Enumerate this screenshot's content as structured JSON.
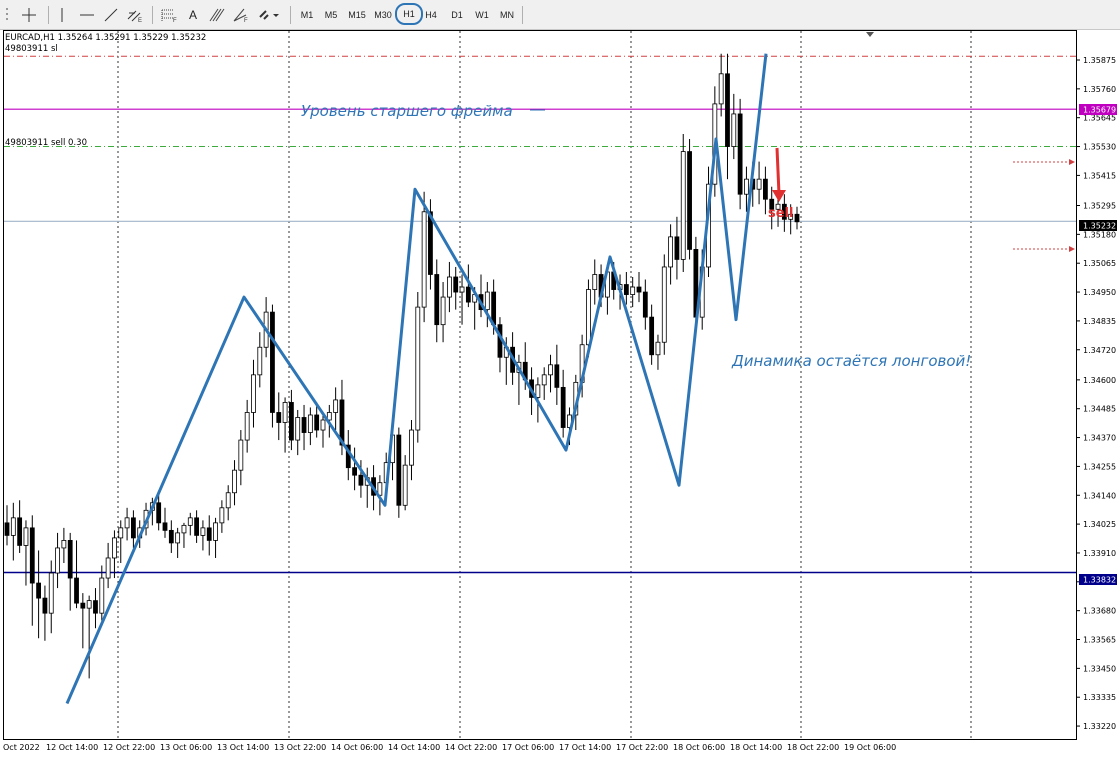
{
  "toolbar": {
    "timeframes": [
      "M1",
      "M5",
      "M15",
      "M30",
      "H1",
      "H4",
      "D1",
      "W1",
      "MN"
    ],
    "selected_timeframe": "H1",
    "tools": [
      "crosshair-icon",
      "vertical-line-icon",
      "horizontal-line-icon",
      "trendline-icon",
      "channel-icon",
      "fibonacci-icon",
      "text-icon",
      "andrews-pitchfork-icon",
      "gann-icon",
      "shapes-icon"
    ],
    "text_tool_label": "A"
  },
  "chart": {
    "info_line": "EURCAD,H1  1.35264 1.35291 1.35229 1.35232",
    "order_sl_label": "49803911 sl",
    "order_sell_label": "49803911 sell 0.30",
    "bid_label": "1.35232",
    "level_label": "1.35679",
    "support_label": "1.33832",
    "annotation_level": "Уровень старшего фрейма",
    "annotation_dynamics": "Динамика остаётся лонговой!",
    "annotation_sell": "sell",
    "colors": {
      "level_magenta": "#c000c0",
      "support_navy": "#00008b",
      "bid_line": "#a0b4c8",
      "sl_line": "#d04040",
      "sell_line": "#3caa3c",
      "zigzag": "#2e75b6",
      "sell_arrow": "#e03030",
      "annotation_blue": "#2e75b6"
    }
  },
  "price_axis": {
    "ticks": [
      "1.35875",
      "1.35760",
      "1.35645",
      "1.35530",
      "1.35415",
      "1.35295",
      "1.35180",
      "1.35065",
      "1.34950",
      "1.34835",
      "1.34720",
      "1.34600",
      "1.34485",
      "1.34370",
      "1.34255",
      "1.34140",
      "1.34025",
      "1.33910",
      "1.33795",
      "1.33680",
      "1.33565",
      "1.33450",
      "1.33335",
      "1.33220"
    ]
  },
  "time_axis": {
    "labels": [
      "Oct 2022",
      "12 Oct 14:00",
      "12 Oct 22:00",
      "13 Oct 06:00",
      "13 Oct 14:00",
      "13 Oct 22:00",
      "14 Oct 06:00",
      "14 Oct 14:00",
      "14 Oct 22:00",
      "17 Oct 06:00",
      "17 Oct 14:00",
      "17 Oct 22:00",
      "18 Oct 06:00",
      "18 Oct 14:00",
      "18 Oct 22:00",
      "19 Oct 06:00"
    ]
  },
  "chart_data": {
    "type": "candlestick",
    "symbol": "EURCAD",
    "timeframe": "H1",
    "ylim": [
      1.3322,
      1.3598
    ],
    "levels": [
      {
        "value": 1.35679
      },
      {
        "value": 1.33832
      },
      {
        "value": 1.35232
      },
      {
        "value": 1.3589
      },
      {
        "value": 1.3553
      }
    ],
    "candles": [
      [
        1.3403,
        1.341,
        1.3394,
        1.3398
      ],
      [
        1.3398,
        1.3411,
        1.3388,
        1.3405
      ],
      [
        1.3405,
        1.3412,
        1.3391,
        1.3394
      ],
      [
        1.3394,
        1.3404,
        1.3378,
        1.3401
      ],
      [
        1.3401,
        1.3406,
        1.3362,
        1.3379
      ],
      [
        1.3379,
        1.3392,
        1.3357,
        1.3373
      ],
      [
        1.3373,
        1.3378,
        1.3356,
        1.3367
      ],
      [
        1.3367,
        1.3388,
        1.3359,
        1.3383
      ],
      [
        1.3383,
        1.3399,
        1.3377,
        1.3393
      ],
      [
        1.3393,
        1.3401,
        1.3387,
        1.3396
      ],
      [
        1.3396,
        1.3399,
        1.3368,
        1.3381
      ],
      [
        1.3381,
        1.3396,
        1.3369,
        1.3371
      ],
      [
        1.3371,
        1.3375,
        1.3353,
        1.3369
      ],
      [
        1.3369,
        1.3374,
        1.3341,
        1.3372
      ],
      [
        1.3372,
        1.3377,
        1.3361,
        1.3367
      ],
      [
        1.3367,
        1.3386,
        1.3364,
        1.3381
      ],
      [
        1.3381,
        1.3395,
        1.3377,
        1.3389
      ],
      [
        1.3389,
        1.34,
        1.3381,
        1.3397
      ],
      [
        1.3397,
        1.3404,
        1.3387,
        1.3401
      ],
      [
        1.3401,
        1.3409,
        1.3396,
        1.3405
      ],
      [
        1.3405,
        1.3408,
        1.3393,
        1.3397
      ],
      [
        1.3397,
        1.3404,
        1.3393,
        1.3401
      ],
      [
        1.3401,
        1.3411,
        1.3398,
        1.3408
      ],
      [
        1.3408,
        1.3413,
        1.3402,
        1.3411
      ],
      [
        1.3411,
        1.3414,
        1.34,
        1.3403
      ],
      [
        1.3403,
        1.3409,
        1.3397,
        1.34
      ],
      [
        1.34,
        1.3404,
        1.3391,
        1.3395
      ],
      [
        1.3395,
        1.3401,
        1.3389,
        1.3399
      ],
      [
        1.3399,
        1.3403,
        1.3393,
        1.3402
      ],
      [
        1.3402,
        1.3407,
        1.3398,
        1.3405
      ],
      [
        1.3405,
        1.3408,
        1.3395,
        1.3398
      ],
      [
        1.3398,
        1.3404,
        1.3392,
        1.3401
      ],
      [
        1.3401,
        1.3406,
        1.339,
        1.3396
      ],
      [
        1.3396,
        1.3405,
        1.3389,
        1.3403
      ],
      [
        1.3403,
        1.3412,
        1.3399,
        1.3409
      ],
      [
        1.3409,
        1.3418,
        1.3404,
        1.3415
      ],
      [
        1.3415,
        1.3428,
        1.341,
        1.3424
      ],
      [
        1.3424,
        1.344,
        1.3418,
        1.3436
      ],
      [
        1.3436,
        1.3452,
        1.3431,
        1.3447
      ],
      [
        1.3447,
        1.3468,
        1.3441,
        1.3462
      ],
      [
        1.3462,
        1.3479,
        1.3457,
        1.3473
      ],
      [
        1.3473,
        1.3493,
        1.3469,
        1.3487
      ],
      [
        1.3487,
        1.349,
        1.3441,
        1.3447
      ],
      [
        1.3447,
        1.3455,
        1.3436,
        1.3443
      ],
      [
        1.3443,
        1.3453,
        1.3431,
        1.3451
      ],
      [
        1.3451,
        1.3456,
        1.3432,
        1.3436
      ],
      [
        1.3436,
        1.3448,
        1.343,
        1.3445
      ],
      [
        1.3445,
        1.345,
        1.3432,
        1.3439
      ],
      [
        1.3439,
        1.3449,
        1.3434,
        1.3446
      ],
      [
        1.3446,
        1.3451,
        1.3437,
        1.344
      ],
      [
        1.344,
        1.3447,
        1.3433,
        1.3444
      ],
      [
        1.3444,
        1.345,
        1.3437,
        1.3447
      ],
      [
        1.3447,
        1.3457,
        1.344,
        1.3452
      ],
      [
        1.3452,
        1.346,
        1.343,
        1.3434
      ],
      [
        1.3434,
        1.344,
        1.342,
        1.3425
      ],
      [
        1.3425,
        1.3433,
        1.3416,
        1.3422
      ],
      [
        1.3422,
        1.3428,
        1.3413,
        1.3418
      ],
      [
        1.3418,
        1.3425,
        1.3409,
        1.3421
      ],
      [
        1.3421,
        1.3426,
        1.3408,
        1.3414
      ],
      [
        1.3414,
        1.3422,
        1.3406,
        1.3419
      ],
      [
        1.3419,
        1.3431,
        1.3415,
        1.3427
      ],
      [
        1.3427,
        1.3445,
        1.342,
        1.3438
      ],
      [
        1.3438,
        1.3441,
        1.3405,
        1.341
      ],
      [
        1.341,
        1.343,
        1.3408,
        1.3426
      ],
      [
        1.3426,
        1.3444,
        1.342,
        1.344
      ],
      [
        1.344,
        1.3495,
        1.3435,
        1.3489
      ],
      [
        1.3489,
        1.3535,
        1.3483,
        1.3527
      ],
      [
        1.3527,
        1.3532,
        1.3496,
        1.3502
      ],
      [
        1.3502,
        1.3508,
        1.3475,
        1.3482
      ],
      [
        1.3482,
        1.3499,
        1.3475,
        1.3493
      ],
      [
        1.3493,
        1.3507,
        1.3487,
        1.3501
      ],
      [
        1.3501,
        1.3505,
        1.3488,
        1.3495
      ],
      [
        1.3495,
        1.3502,
        1.3482,
        1.3497
      ],
      [
        1.3497,
        1.3506,
        1.3489,
        1.3491
      ],
      [
        1.3491,
        1.3497,
        1.348,
        1.3494
      ],
      [
        1.3494,
        1.3502,
        1.3485,
        1.3488
      ],
      [
        1.3488,
        1.3499,
        1.3481,
        1.3495
      ],
      [
        1.3495,
        1.35,
        1.3478,
        1.3482
      ],
      [
        1.3482,
        1.3485,
        1.3463,
        1.3469
      ],
      [
        1.3469,
        1.3477,
        1.3458,
        1.3473
      ],
      [
        1.3473,
        1.3479,
        1.3458,
        1.3463
      ],
      [
        1.3463,
        1.347,
        1.345,
        1.3467
      ],
      [
        1.3467,
        1.3475,
        1.3456,
        1.346
      ],
      [
        1.346,
        1.3465,
        1.3446,
        1.3453
      ],
      [
        1.3453,
        1.3461,
        1.3443,
        1.3458
      ],
      [
        1.3458,
        1.3465,
        1.3452,
        1.3462
      ],
      [
        1.3462,
        1.347,
        1.3455,
        1.3466
      ],
      [
        1.3466,
        1.3474,
        1.345,
        1.3457
      ],
      [
        1.3457,
        1.3464,
        1.3437,
        1.3441
      ],
      [
        1.3441,
        1.3449,
        1.3434,
        1.3446
      ],
      [
        1.3446,
        1.3462,
        1.344,
        1.3459
      ],
      [
        1.3459,
        1.3478,
        1.3453,
        1.3474
      ],
      [
        1.3474,
        1.35,
        1.3469,
        1.3496
      ],
      [
        1.3496,
        1.3508,
        1.349,
        1.3502
      ],
      [
        1.3502,
        1.3506,
        1.3489,
        1.3493
      ],
      [
        1.3493,
        1.3506,
        1.3486,
        1.3503
      ],
      [
        1.3503,
        1.3507,
        1.3492,
        1.3496
      ],
      [
        1.3496,
        1.3502,
        1.3488,
        1.3498
      ],
      [
        1.3498,
        1.3503,
        1.349,
        1.3494
      ],
      [
        1.3494,
        1.3501,
        1.3489,
        1.3497
      ],
      [
        1.3497,
        1.3503,
        1.3491,
        1.3495
      ],
      [
        1.3495,
        1.35,
        1.348,
        1.3485
      ],
      [
        1.3485,
        1.349,
        1.3466,
        1.347
      ],
      [
        1.347,
        1.3478,
        1.3464,
        1.3475
      ],
      [
        1.3475,
        1.351,
        1.347,
        1.3505
      ],
      [
        1.3505,
        1.3522,
        1.3498,
        1.3517
      ],
      [
        1.3517,
        1.3525,
        1.35,
        1.3508
      ],
      [
        1.3508,
        1.3558,
        1.3503,
        1.3551
      ],
      [
        1.3551,
        1.3556,
        1.3508,
        1.3512
      ],
      [
        1.3512,
        1.3517,
        1.3481,
        1.3485
      ],
      [
        1.3485,
        1.3512,
        1.348,
        1.3505
      ],
      [
        1.3505,
        1.3545,
        1.3501,
        1.3538
      ],
      [
        1.3538,
        1.3577,
        1.3533,
        1.357
      ],
      [
        1.357,
        1.359,
        1.3565,
        1.3582
      ],
      [
        1.3582,
        1.359,
        1.354,
        1.3553
      ],
      [
        1.3553,
        1.3574,
        1.3548,
        1.3566
      ],
      [
        1.3566,
        1.3572,
        1.3528,
        1.3534
      ],
      [
        1.3534,
        1.3545,
        1.3527,
        1.354
      ],
      [
        1.354,
        1.3547,
        1.3529,
        1.3536
      ],
      [
        1.3536,
        1.3547,
        1.353,
        1.354
      ],
      [
        1.354,
        1.3545,
        1.3526,
        1.3532
      ],
      [
        1.3532,
        1.3537,
        1.352,
        1.3528
      ],
      [
        1.3528,
        1.3534,
        1.3521,
        1.353
      ],
      [
        1.353,
        1.3534,
        1.3519,
        1.3524
      ],
      [
        1.3524,
        1.353,
        1.3518,
        1.3526
      ],
      [
        1.3526,
        1.3529,
        1.352,
        1.3523
      ]
    ],
    "zigzag": [
      [
        1.3331,
        1.3493
      ],
      [
        1.341,
        1.3536
      ],
      [
        1.3432,
        1.3509
      ],
      [
        1.3418,
        1.3556
      ],
      [
        1.3484,
        1.359
      ]
    ]
  }
}
